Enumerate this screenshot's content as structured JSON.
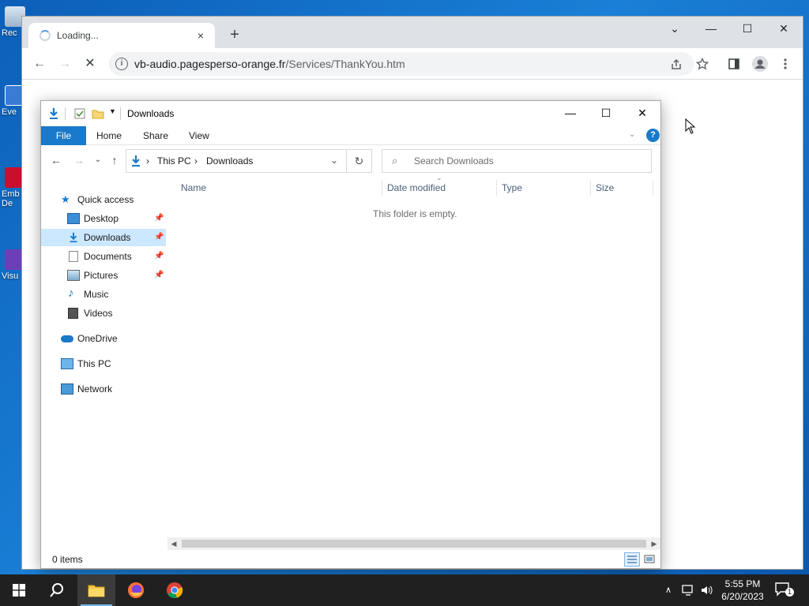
{
  "desktop": {
    "icons": [
      {
        "name": "recycle-bin",
        "label": "Rec"
      },
      {
        "name": "eve-shortcut",
        "label": "Eve"
      },
      {
        "name": "embedded-shortcut",
        "label": "Emb De"
      },
      {
        "name": "visual-studio-shortcut",
        "label": "Visu"
      }
    ]
  },
  "browser": {
    "tab": {
      "title": "Loading...",
      "close": "×"
    },
    "new_tab": "+",
    "controls": {
      "tabsearch": "⌄",
      "minimize": "—",
      "maximize": "☐",
      "close": "✕"
    },
    "toolbar": {
      "back": "←",
      "forward": "→",
      "stop": "✕"
    },
    "omnibox": {
      "host": "vb-audio.pagesperso-orange.fr",
      "path": "/Services/ThankYou.htm",
      "info": "i"
    }
  },
  "explorer": {
    "title": "Downloads",
    "controls": {
      "minimize": "—",
      "maximize": "☐",
      "close": "✕"
    },
    "ribbon": {
      "file": "File",
      "home": "Home",
      "share": "Share",
      "view": "View",
      "help": "?"
    },
    "address": {
      "crumbs": [
        "This PC",
        "Downloads"
      ]
    },
    "search_placeholder": "Search Downloads",
    "nav": {
      "quick_access": "Quick access",
      "items": [
        {
          "label": "Desktop",
          "pinned": true
        },
        {
          "label": "Downloads",
          "pinned": true,
          "selected": true
        },
        {
          "label": "Documents",
          "pinned": true
        },
        {
          "label": "Pictures",
          "pinned": true
        },
        {
          "label": "Music",
          "pinned": false
        },
        {
          "label": "Videos",
          "pinned": false
        }
      ],
      "onedrive": "OneDrive",
      "this_pc": "This PC",
      "network": "Network"
    },
    "columns": {
      "name": "Name",
      "date_modified": "Date modified",
      "type": "Type",
      "size": "Size"
    },
    "empty_message": "This folder is empty.",
    "status": {
      "count": "0 items"
    }
  },
  "taskbar": {
    "time": "5:55 PM",
    "date": "6/20/2023",
    "notification_count": "1"
  },
  "colors": {
    "desktop": "#0c5fb8",
    "accent": "#1979ca",
    "taskbar": "#202020",
    "selection": "#cce8ff"
  }
}
